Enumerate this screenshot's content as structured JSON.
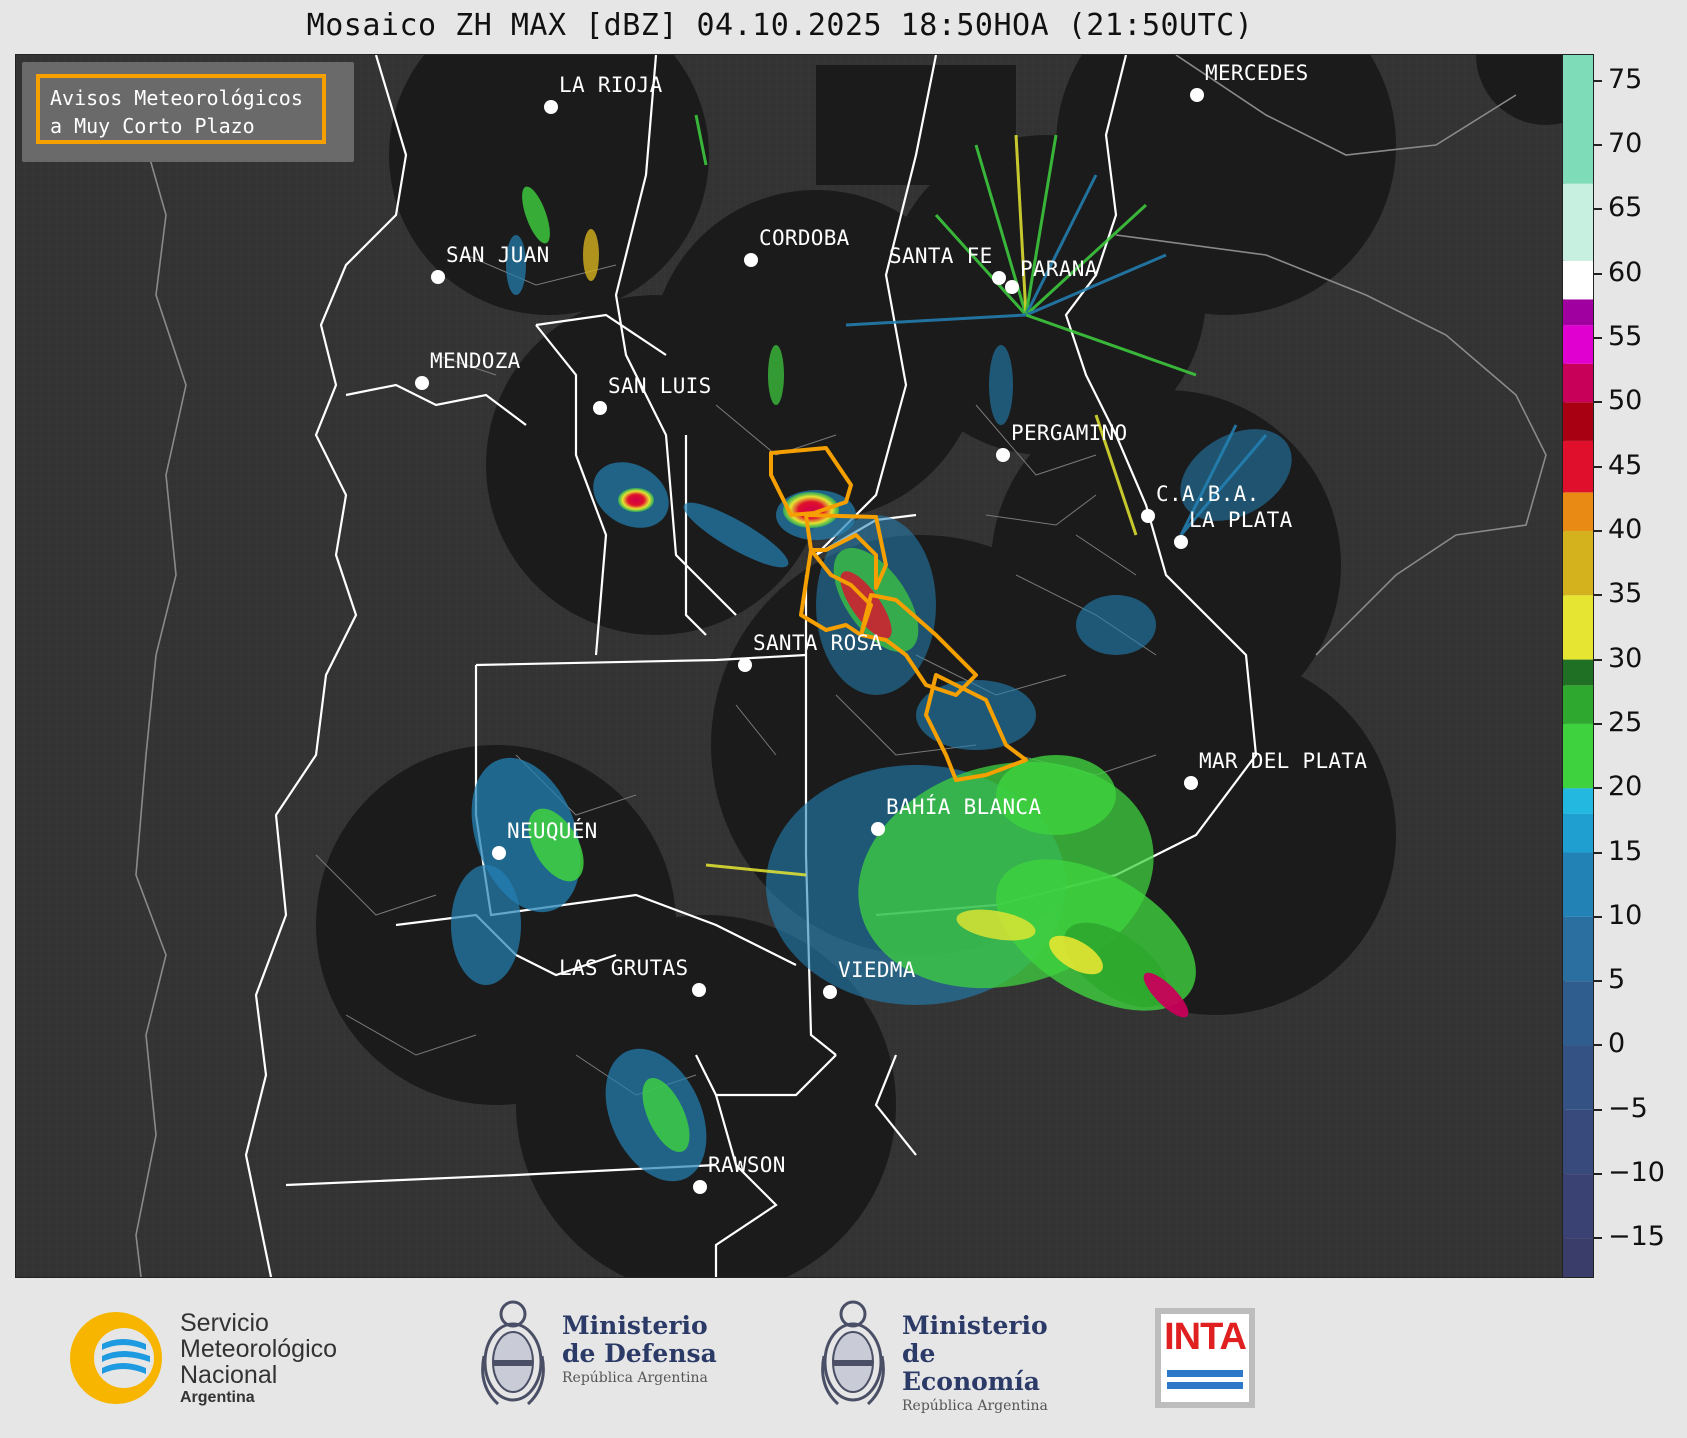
{
  "title": "Mosaico ZH MAX [dBZ] 04.10.2025 18:50HOA (21:50UTC)",
  "legend": {
    "line1": "Avisos Meteorológicos",
    "line2": "a Muy Corto Plazo",
    "border_color": "#f5a000"
  },
  "cities": [
    {
      "name": "LA RIOJA"
    },
    {
      "name": "MERCEDES"
    },
    {
      "name": "SAN JUAN"
    },
    {
      "name": "CORDOBA"
    },
    {
      "name": "SANTA FE"
    },
    {
      "name": "PARANA"
    },
    {
      "name": "MENDOZA"
    },
    {
      "name": "SAN LUIS"
    },
    {
      "name": "PERGAMINO"
    },
    {
      "name": "C.A.B.A."
    },
    {
      "name": "LA PLATA"
    },
    {
      "name": "SANTA ROSA"
    },
    {
      "name": "MAR DEL PLATA"
    },
    {
      "name": "BAHÍA BLANCA"
    },
    {
      "name": "NEUQUÉN"
    },
    {
      "name": "LAS GRUTAS"
    },
    {
      "name": "VIEDMA"
    },
    {
      "name": "RAWSON"
    }
  ],
  "colorbar": {
    "unit": "dBZ",
    "ticks": [
      "75",
      "70",
      "65",
      "60",
      "55",
      "50",
      "45",
      "40",
      "35",
      "30",
      "25",
      "20",
      "15",
      "10",
      "5",
      "0",
      "−5",
      "−10",
      "−15"
    ],
    "min": -18,
    "max": 77,
    "bands": [
      {
        "from": -18,
        "to": -15,
        "color": "#3a3d6a"
      },
      {
        "from": -15,
        "to": -10,
        "color": "#3a4273"
      },
      {
        "from": -10,
        "to": -5,
        "color": "#38497c"
      },
      {
        "from": -5,
        "to": 0,
        "color": "#345384"
      },
      {
        "from": 0,
        "to": 5,
        "color": "#2f5e8e"
      },
      {
        "from": 5,
        "to": 10,
        "color": "#2a6f9f"
      },
      {
        "from": 10,
        "to": 15,
        "color": "#2382b5"
      },
      {
        "from": 15,
        "to": 18,
        "color": "#1f9fd0"
      },
      {
        "from": 18,
        "to": 20,
        "color": "#22b8e0"
      },
      {
        "from": 20,
        "to": 25,
        "color": "#3fd23f"
      },
      {
        "from": 25,
        "to": 28,
        "color": "#2ea82e"
      },
      {
        "from": 28,
        "to": 30,
        "color": "#1f6f25"
      },
      {
        "from": 30,
        "to": 35,
        "color": "#e6e632"
      },
      {
        "from": 35,
        "to": 40,
        "color": "#d4b21e"
      },
      {
        "from": 40,
        "to": 43,
        "color": "#e88a14"
      },
      {
        "from": 43,
        "to": 47,
        "color": "#e0102c"
      },
      {
        "from": 47,
        "to": 50,
        "color": "#a80012"
      },
      {
        "from": 50,
        "to": 53,
        "color": "#c8005a"
      },
      {
        "from": 53,
        "to": 56,
        "color": "#e000d0"
      },
      {
        "from": 56,
        "to": 58,
        "color": "#a000a0"
      },
      {
        "from": 58,
        "to": 61,
        "color": "#ffffff"
      },
      {
        "from": 61,
        "to": 67,
        "color": "#c8f0e0"
      },
      {
        "from": 67,
        "to": 77,
        "color": "#7fdcb8"
      }
    ]
  },
  "colors": {
    "map_background": "#333333",
    "radar_coverage": "#1b1b1b",
    "borders": "#ffffff",
    "warning_polygon": "#f5a000"
  },
  "footer": {
    "smn": {
      "line1": "Servicio",
      "line2": "Meteorológico",
      "line3": "Nacional",
      "line4": "Argentina"
    },
    "defensa": {
      "line1": "Ministerio",
      "line2": "de Defensa",
      "line3": "República Argentina"
    },
    "economia": {
      "line1": "Ministerio",
      "line2": "de Economía",
      "line3": "República Argentina"
    },
    "inta": {
      "label": "INTA"
    }
  }
}
